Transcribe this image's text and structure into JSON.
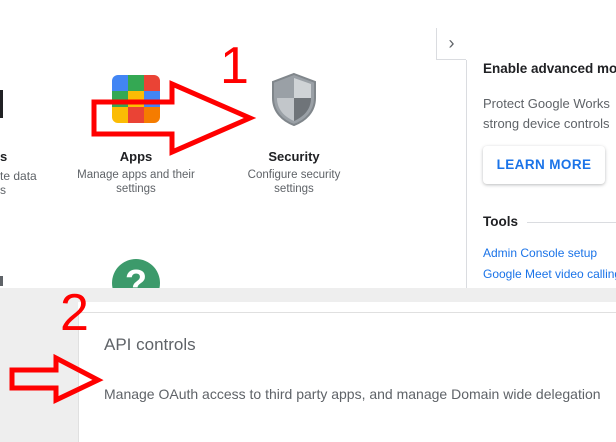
{
  "partial_left": {
    "heading": "s",
    "desc_line1": "te data",
    "desc_line2": "s"
  },
  "cards": {
    "apps": {
      "icon": "apps-grid-icon",
      "title": "Apps",
      "desc_line1": "Manage apps and their",
      "desc_line2": "settings"
    },
    "security": {
      "icon": "shield-icon",
      "title": "Security",
      "desc_line1": "Configure security",
      "desc_line2": "settings"
    },
    "help": {
      "icon": "help-icon",
      "glyph": "?"
    }
  },
  "side_panel": {
    "collapse_glyph": "›",
    "title": "Enable advanced mob",
    "text_line1": "Protect Google Works",
    "text_line2": "strong device controls",
    "learn_more": "LEARN MORE",
    "tools_title": "Tools",
    "links": [
      "Admin Console setup",
      "Google Meet video calling"
    ]
  },
  "api_controls": {
    "title": "API controls",
    "description": "Manage OAuth access to third party apps, and manage Domain wide delegation"
  },
  "annotations": {
    "marker_1": "1",
    "marker_2": "2",
    "color": "#ff0000"
  },
  "colors": {
    "link_blue": "#1a73e8",
    "help_green": "#3c9a6b"
  }
}
